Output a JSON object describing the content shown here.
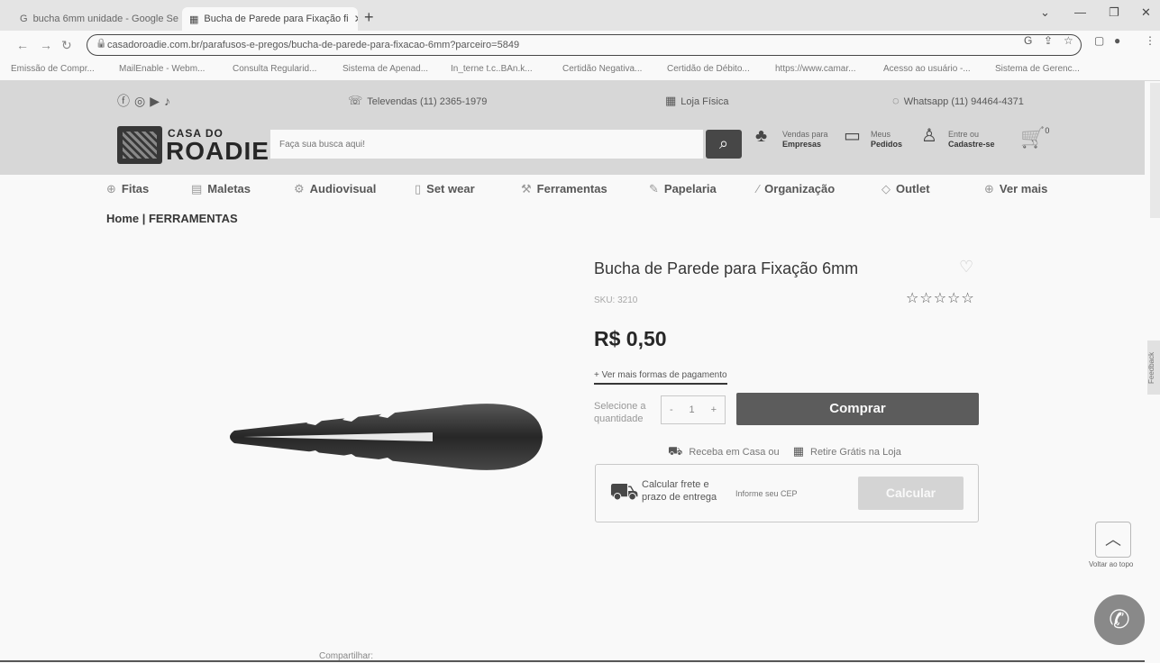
{
  "browser": {
    "tabs": [
      {
        "title": "bucha 6mm unidade - Google Se",
        "active": false
      },
      {
        "title": "Bucha de Parede para Fixação fi",
        "active": true
      }
    ],
    "url": "casadoroadie.com.br/parafusos-e-pregos/bucha-de-parede-para-fixacao-6mm?parceiro=5849",
    "bookmarks": [
      "Emissão de Compr...",
      "MailEnable - Webm...",
      "Consulta Regularid...",
      "Sistema de Apenad...",
      "In_terne t.c..BAn.k...",
      "Certidão Negativa...",
      "Certidão de Débito...",
      "https://www.camar...",
      "Acesso ao usuário -...",
      "Sistema de Gerenc..."
    ]
  },
  "topbar": {
    "televendas": "Televendas (11) 2365-1979",
    "loja": "Loja Física",
    "whatsapp": "Whatsapp (11) 94464-4371"
  },
  "logo": {
    "line1": "CASA DO",
    "line2": "ROADIE"
  },
  "search": {
    "placeholder": "Faça sua busca aqui!"
  },
  "header_actions": [
    {
      "line1": "Vendas para",
      "line2": "Empresas"
    },
    {
      "line1": "Meus",
      "line2": "Pedidos"
    },
    {
      "line1": "Entre ou",
      "line2": "Cadastre-se"
    }
  ],
  "cart": {
    "count": "0"
  },
  "categories": [
    "Fitas",
    "Maletas",
    "Audiovisual",
    "Set wear",
    "Ferramentas",
    "Papelaria",
    "Organização",
    "Outlet",
    "Ver mais"
  ],
  "breadcrumb": "Home | FERRAMENTAS",
  "product": {
    "title": "Bucha de Parede para Fixação 6mm",
    "sku": "SKU: 3210",
    "rating_stars": "☆☆☆☆☆",
    "price": "R$ 0,50",
    "payment_link": "+ Ver mais formas de pagamento",
    "qty_label_1": "Selecione a",
    "qty_label_2": "quantidade",
    "qty_minus": "-",
    "qty_value": "1",
    "qty_plus": "+",
    "buy_label": "Comprar",
    "delivery_home": "Receba em Casa ou",
    "delivery_store": "Retire Grátis na Loja",
    "freight_label_1": "Calcular frete e",
    "freight_label_2": "prazo de entrega",
    "cep_placeholder": "Informe seu CEP",
    "calc_label": "Calcular"
  },
  "widgets": {
    "feedback": "Feedback",
    "back_to_top": "Voltar ao topo",
    "share": "Compartilhar:"
  }
}
